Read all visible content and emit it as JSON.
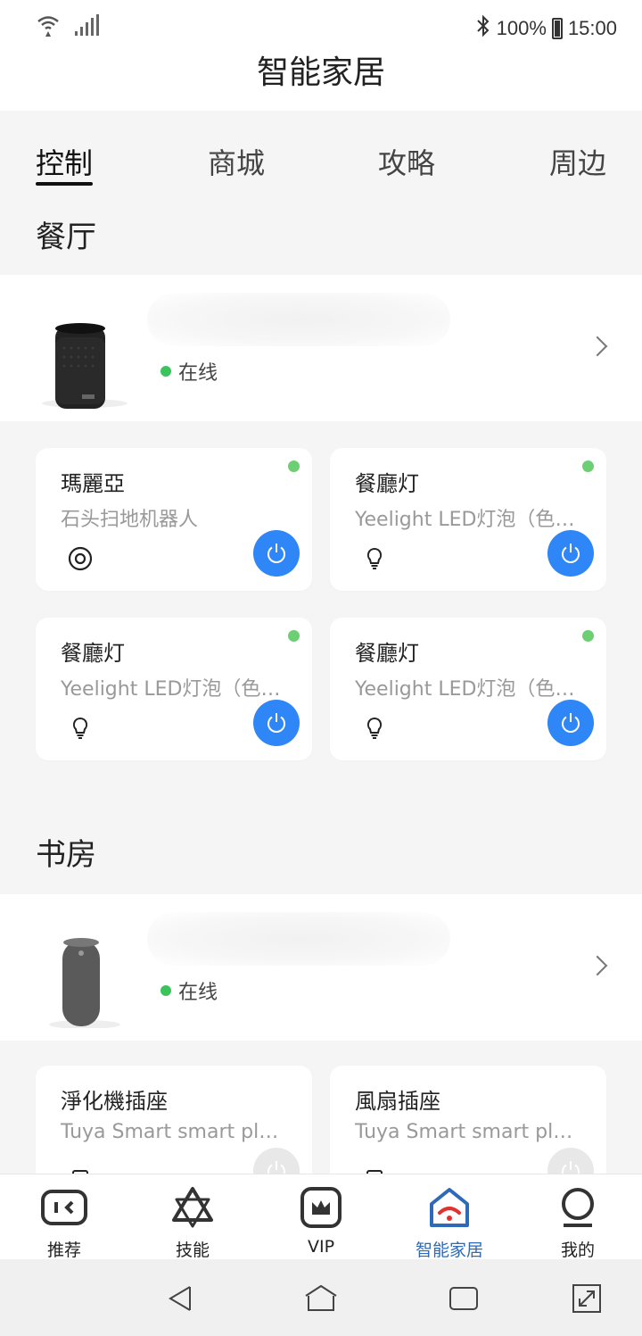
{
  "status_bar": {
    "battery": "100%",
    "time": "15:00"
  },
  "app_bar": {
    "title": "智能家居"
  },
  "tabs": [
    {
      "label": "控制",
      "active": true
    },
    {
      "label": "商城"
    },
    {
      "label": "攻略"
    },
    {
      "label": "周边"
    }
  ],
  "rooms": [
    {
      "name": "餐厅",
      "hub": {
        "status": "在线"
      },
      "devices": [
        {
          "name": "瑪麗亞",
          "model": "石头扫地机器人",
          "icon": "robot-vacuum-icon",
          "online": true,
          "power_on": true
        },
        {
          "name": "餐廳灯",
          "model": "Yeelight LED灯泡（色温版）",
          "icon": "bulb-icon",
          "online": true,
          "power_on": true
        },
        {
          "name": "餐廳灯",
          "model": "Yeelight LED灯泡（色温版）",
          "icon": "bulb-icon",
          "online": true,
          "power_on": true
        },
        {
          "name": "餐廳灯",
          "model": "Yeelight LED灯泡（色温版）",
          "icon": "bulb-icon",
          "online": true,
          "power_on": true
        }
      ]
    },
    {
      "name": "书房",
      "hub": {
        "status": "在线"
      },
      "devices": [
        {
          "name": "淨化機插座",
          "model": "Tuya Smart smart plug",
          "icon": "plug-icon",
          "online": false,
          "power_on": false
        },
        {
          "name": "風扇插座",
          "model": "Tuya Smart smart plug",
          "icon": "plug-icon",
          "online": false,
          "power_on": false
        }
      ]
    }
  ],
  "bottom_nav": [
    {
      "label": "推荐",
      "icon": "tv-icon"
    },
    {
      "label": "技能",
      "icon": "star-of-david-icon"
    },
    {
      "label": "VIP",
      "icon": "crown-icon"
    },
    {
      "label": "智能家居",
      "icon": "smart-home-icon",
      "active": true
    },
    {
      "label": "我的",
      "icon": "profile-icon"
    }
  ],
  "colors": {
    "accent": "#2f86f6",
    "online": "#3bc45c",
    "active_nav": "#2e6ab8"
  }
}
